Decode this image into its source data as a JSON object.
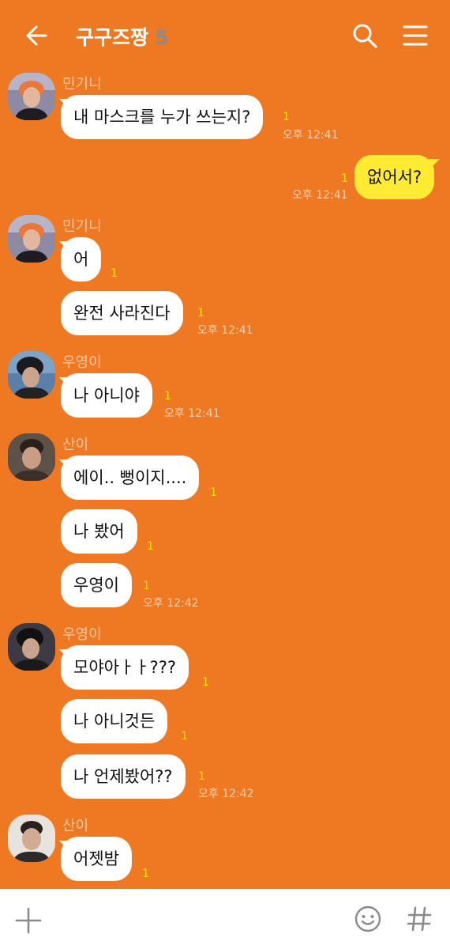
{
  "header": {
    "title": "구구즈짱",
    "member_count": "5",
    "icons": [
      "back-arrow-icon",
      "search-icon",
      "menu-icon"
    ]
  },
  "messages": [
    {
      "sender": "민기니",
      "text": "내 마스크를 누가 쓰는지?",
      "unread": "1",
      "time": "오후 12:41"
    },
    {
      "sender": "me",
      "text": "없어서?",
      "unread": "1",
      "time": "오후 12:41"
    },
    {
      "sender": "민기니",
      "text": "어",
      "unread": "1"
    },
    {
      "sender": "민기니",
      "text": "완전 사라진다",
      "unread": "1",
      "time": "오후 12:41"
    },
    {
      "sender": "우영이",
      "text": "나 아니야",
      "unread": "1",
      "time": "오후 12:41"
    },
    {
      "sender": "산이",
      "text": "에이.. 뻥이지....",
      "unread": "1"
    },
    {
      "sender": "산이",
      "text": "나 봤어",
      "unread": "1"
    },
    {
      "sender": "산이",
      "text": "우영이",
      "unread": "1",
      "time": "오후 12:42"
    },
    {
      "sender": "우영이",
      "text": "모야아ㅏㅏ???",
      "unread": "1"
    },
    {
      "sender": "우영이",
      "text": "나 아니것든",
      "unread": "1"
    },
    {
      "sender": "우영이",
      "text": "나 언제봤어??",
      "unread": "1",
      "time": "오후 12:42"
    },
    {
      "sender": "산이",
      "text": "어젯밤",
      "unread": "1"
    }
  ],
  "footer": {
    "icons": [
      "plus-icon",
      "emoji-icon",
      "hashtag-icon"
    ]
  },
  "colors": {
    "background": "#ef7823",
    "my_bubble": "#ffeb33",
    "other_bubble": "#ffffff",
    "unread": "#ffe600"
  }
}
